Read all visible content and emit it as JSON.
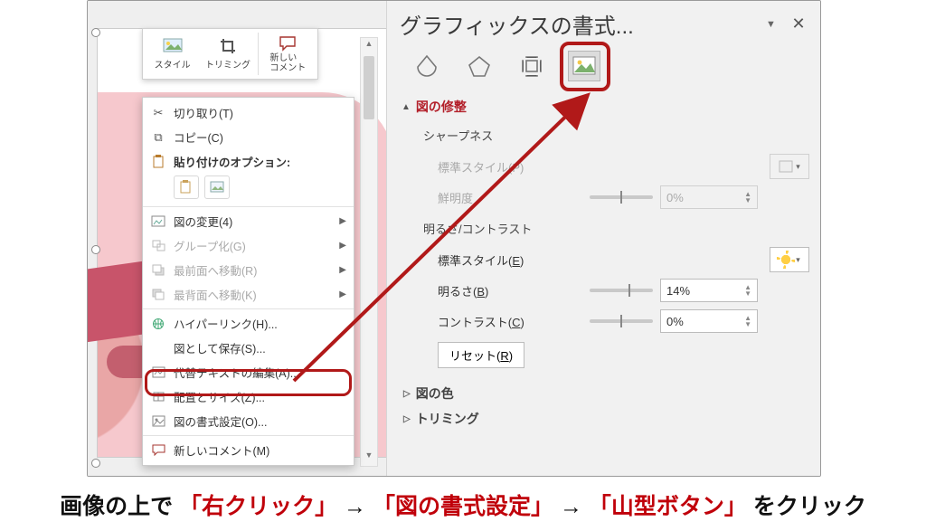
{
  "mini_toolbar": {
    "style": "スタイル",
    "crop": "トリミング",
    "new_comment": "新しい\nコメント"
  },
  "context_menu": {
    "cut": "切り取り(T)",
    "copy": "コピー(C)",
    "paste_header": "貼り付けのオプション:",
    "change_picture": "図の変更(4)",
    "group": "グループ化(G)",
    "bring_front": "最前面へ移動(R)",
    "send_back": "最背面へ移動(K)",
    "hyperlink": "ハイパーリンク(H)...",
    "save_as_pic": "図として保存(S)...",
    "alt_text": "代替テキストの編集(A)...",
    "size_pos": "配置とサイズ(Z)...",
    "format_picture": "図の書式設定(O)...",
    "new_comment": "新しいコメント(M)"
  },
  "format_pane": {
    "title": "グラフィックスの書式...",
    "section_corrections": "図の修整",
    "sharpness": "シャープネス",
    "preset_style_p": "標準スタイル(P)",
    "sharpness_amount": "鮮明度",
    "brightness_contrast": "明るさ/コントラスト",
    "preset_style_e": "標準スタイル(E)",
    "brightness": "明るさ(B)",
    "contrast": "コントラスト(C)",
    "reset": "リセット(R)",
    "section_color": "図の色",
    "section_crop": "トリミング",
    "values": {
      "sharpness_pct": "0%",
      "brightness_pct": "14%",
      "contrast_pct": "0%"
    }
  },
  "caption": {
    "p1": "画像の上で",
    "p2": "「右クリック」",
    "arrow": "→",
    "p3": "「図の書式設定」",
    "p4": "「山型ボタン」",
    "p5": "をクリック"
  }
}
